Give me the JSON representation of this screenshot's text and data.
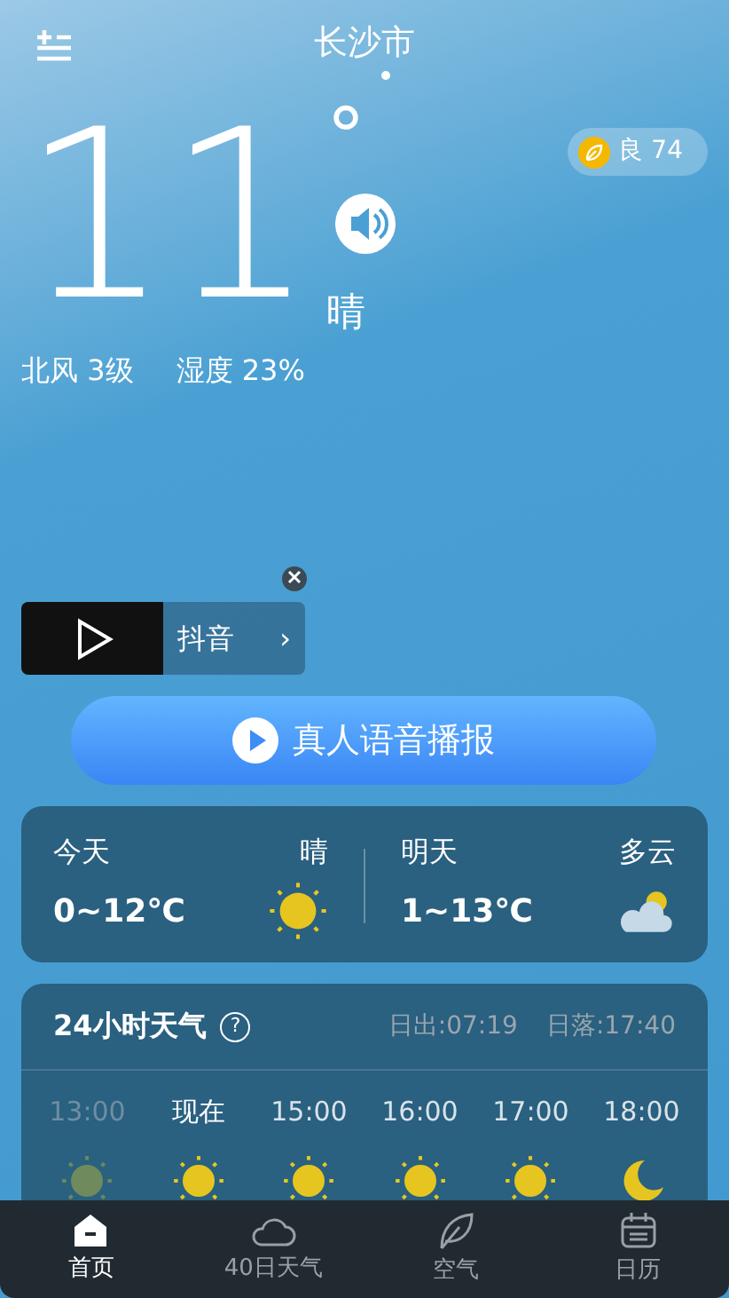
{
  "header": {
    "city": "长沙市"
  },
  "current": {
    "temperature": "11",
    "degree": "°",
    "condition": "晴",
    "wind": "北风 3级",
    "humidity": "湿度 23%"
  },
  "air_quality": {
    "label": "良 74"
  },
  "ad": {
    "title": "抖音",
    "chevron": "›"
  },
  "voice_button": {
    "label": "真人语音播报"
  },
  "forecast": [
    {
      "day": "今天",
      "condition": "晴",
      "range": "0~12℃",
      "kind": "sun"
    },
    {
      "day": "明天",
      "condition": "多云",
      "range": "1~13℃",
      "kind": "cloudy"
    }
  ],
  "hourly": {
    "title": "24小时天气",
    "help": "?",
    "sunrise": "日出:07:19",
    "sunset": "日落:17:40",
    "hours": [
      {
        "time": "13:00",
        "past": true,
        "kind": "sun"
      },
      {
        "time": "现在",
        "past": false,
        "kind": "sun"
      },
      {
        "time": "15:00",
        "past": false,
        "kind": "sun"
      },
      {
        "time": "16:00",
        "past": false,
        "kind": "sun"
      },
      {
        "time": "17:00",
        "past": false,
        "kind": "sun"
      },
      {
        "time": "18:00",
        "past": false,
        "kind": "moon"
      }
    ]
  },
  "bottom_nav": [
    {
      "label": "首页",
      "selected": true,
      "kind": "home"
    },
    {
      "label": "40日天气",
      "selected": false,
      "kind": "cloud"
    },
    {
      "label": "空气",
      "selected": false,
      "kind": "leaf"
    },
    {
      "label": "日历",
      "selected": false,
      "kind": "calendar"
    }
  ]
}
